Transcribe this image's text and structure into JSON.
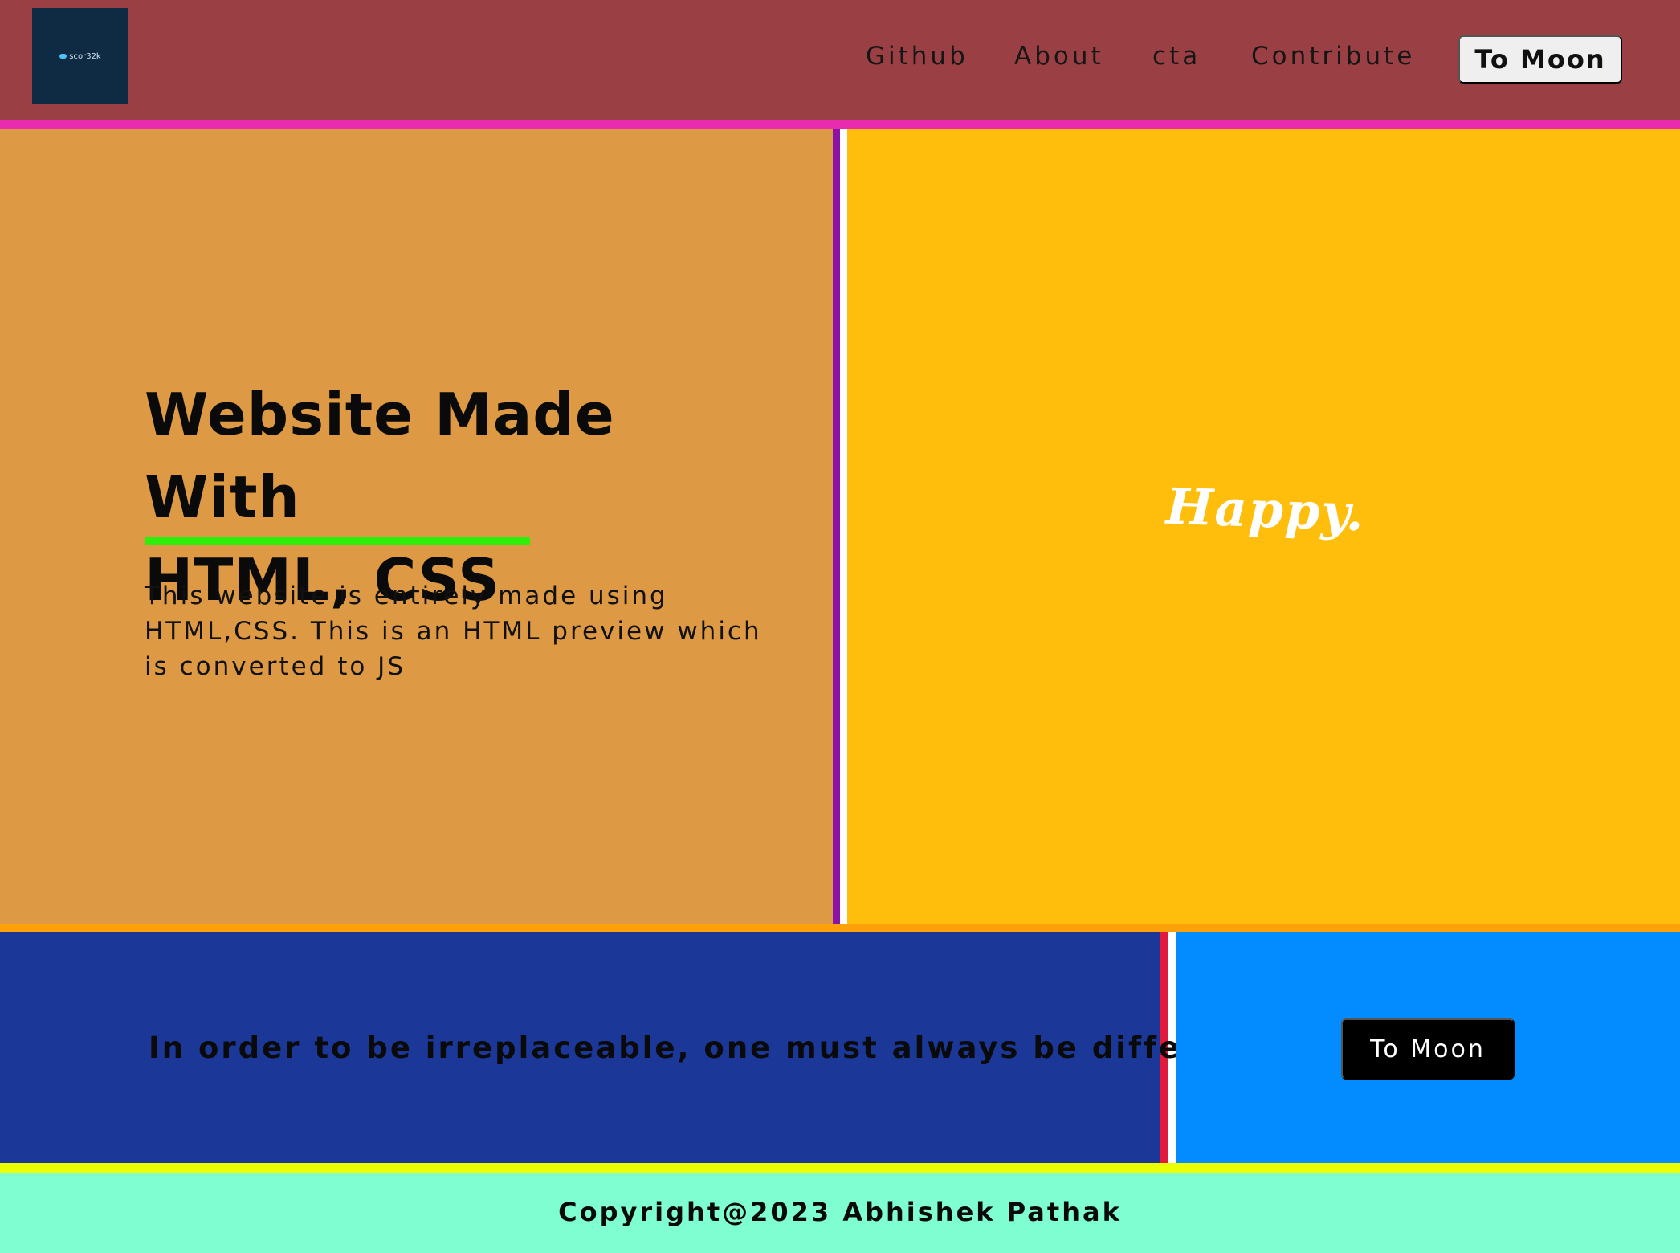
{
  "header": {
    "logo_text": "scor32k",
    "nav_links": [
      "Github",
      "About",
      "cta",
      "Contribute"
    ],
    "cta_label": "To Moon"
  },
  "hero": {
    "title_line1": "Website Made With",
    "title_line2": "HTML, CSS",
    "description_line1": "This website is entirely made using",
    "description_line2": "HTML,CSS. This is an HTML preview which",
    "description_line3": "is converted to JS",
    "image_text": "Happy."
  },
  "band": {
    "quote": "In order to be irreplaceable, one must always be different",
    "cta_label": "To Moon"
  },
  "footer": {
    "copyright": "Copyright@2023 Abhishek Pathak"
  },
  "colors": {
    "header_bg": "#9a4044",
    "header_border": "#e92bb0",
    "hero_left_bg": "#de9944",
    "hero_divider": "#8d12a6",
    "hero_right_bg": "#ffbe0b",
    "underline": "#2eef0b",
    "band_border": "#fea00a",
    "band_left_bg": "#1b3797",
    "band_divider": "#e01a3c",
    "band_right_bg": "#038cff",
    "footer_border": "#eaff00",
    "footer_bg": "#7ffed1"
  }
}
